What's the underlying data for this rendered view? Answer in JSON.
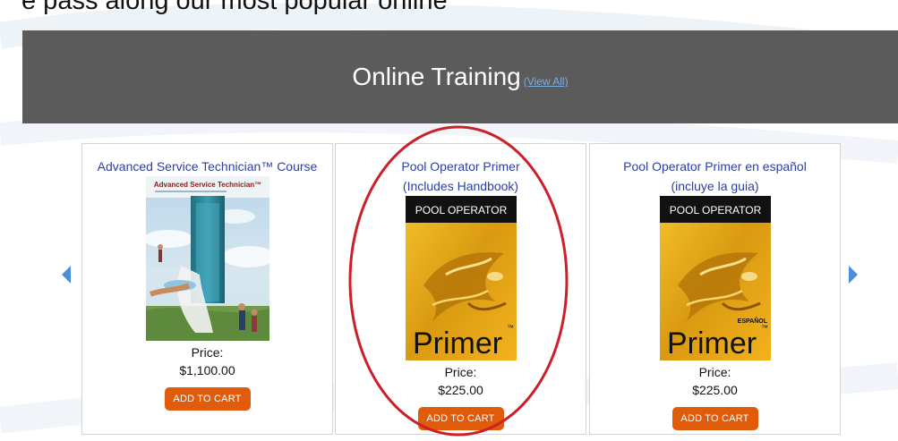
{
  "top_heading": "e pass along our most popular online",
  "banner": {
    "title": "Online Training",
    "view_all": "(View All)",
    "background": "#5b5b5b"
  },
  "products": [
    {
      "title_line1": "Advanced Service Technician™ Course",
      "title_line2": "",
      "cover_icon": "advanced-service-technician-cover-image",
      "cover_text": "Advanced Service Technician™",
      "price_label": "Price:",
      "price": "$1,100.00",
      "button": "ADD TO CART"
    },
    {
      "title_line1": "Pool Operator Primer",
      "title_line2": "(Includes Handbook)",
      "cover_icon": "pool-operator-primer-cover-image",
      "cover_top": "POOL OPERATOR",
      "cover_word": "Primer",
      "cover_tm": "™",
      "price_label": "Price:",
      "price": "$225.00",
      "button": "ADD TO CART"
    },
    {
      "title_line1": "Pool Operator Primer en español",
      "title_line2": "(incluye la guia)",
      "cover_icon": "pool-operator-primer-espanol-cover-image",
      "cover_top": "POOL OPERATOR",
      "cover_badge": "ESPAÑOL",
      "cover_word": "Primer",
      "cover_tm": "™",
      "price_label": "Price:",
      "price": "$225.00",
      "button": "ADD TO CART"
    }
  ],
  "colors": {
    "link": "#2c3fa3",
    "button": "#e05b0a",
    "arrow": "#4a90d9",
    "highlight": "#cc1f2a"
  }
}
